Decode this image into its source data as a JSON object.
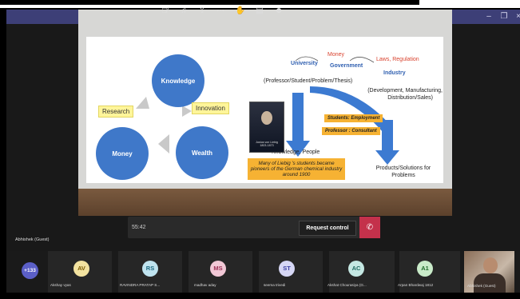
{
  "window": {
    "controls": {
      "minimize_glyph": "–",
      "restore_glyph": "❐",
      "close_glyph": "×"
    }
  },
  "slide": {
    "left": {
      "circle_knowledge": "Knowledge",
      "circle_money": "Money",
      "circle_wealth": "Wealth",
      "box_research": "Research",
      "box_innovation": "Innovation"
    },
    "right": {
      "money": "Money",
      "laws": "Laws, Regulation",
      "university": "University",
      "government": "Government",
      "industry": "Industry",
      "professor_line": "(Professor/Student/Problem/Thesis)",
      "development_line1": "(Development, Manufacturing,",
      "development_line2": "Distribution/Sales)",
      "students_employment": "Students: Employment",
      "professor_consultant": "Professor : Consultant",
      "knowledge_people": "Knowledge, People",
      "products_line1": "Products/Solutions for",
      "products_line2": "Problems",
      "portrait_caption1": "Justus von Liebig",
      "portrait_caption2": "1803-1873",
      "note": "Many of Liebig 's students became pioneers of the German chemical industry around 1900"
    }
  },
  "toolbar": {
    "timer": "55:42",
    "request_control": "Request control",
    "icons": [
      "camera-off-icon",
      "mic-off-icon",
      "share-icon",
      "more-icon",
      "raise-hand-icon",
      "chat-icon",
      "participants-icon",
      "hang-up-icon"
    ]
  },
  "guest_label": "Abhishek (Guest)",
  "participants": {
    "overflow": "+133",
    "list": [
      {
        "initials": "AV",
        "name": "Akshay vyas",
        "color": "#c6a000"
      },
      {
        "initials": "RS",
        "name": "RAVINDRA PRATAP S...",
        "color": "#3d9ab5"
      },
      {
        "initials": "MS",
        "name": "madhav aday",
        "color": "#c84a72"
      },
      {
        "initials": "ST",
        "name": "seema trivedi",
        "color": "#5b5fc7"
      },
      {
        "initials": "AC",
        "name": "Akshat Chourasiya (G...",
        "color": "#2f8f84"
      },
      {
        "initials": "A1",
        "name": "Arpan Bhardwaj 1812",
        "color": "#2f8f3a"
      }
    ],
    "self_label": "Abhishek (Guest)"
  }
}
